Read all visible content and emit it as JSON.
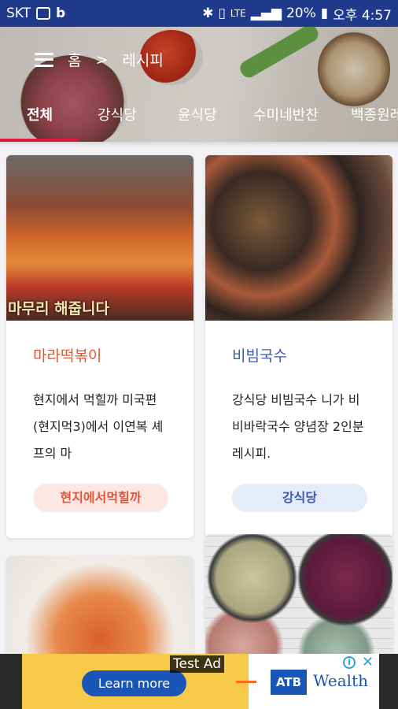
{
  "status_bar": {
    "carrier": "SKT",
    "network": "LTE",
    "battery": "20%",
    "time": "오후 4:57",
    "icons": [
      "gallery-icon",
      "b-app-icon",
      "bluetooth-icon",
      "vibrate-icon",
      "signal-icon",
      "battery-icon"
    ]
  },
  "header": {
    "breadcrumb": {
      "home": "홈",
      "separator": ">",
      "current": "레시피"
    },
    "tabs": [
      {
        "label": "전체",
        "active": true
      },
      {
        "label": "강식당",
        "active": false
      },
      {
        "label": "윤식당",
        "active": false
      },
      {
        "label": "수미네반찬",
        "active": false
      },
      {
        "label": "백종원레",
        "active": false
      }
    ],
    "indicator_color": "#e0143c"
  },
  "recipes": [
    {
      "image_caption": "마무리 해줍니다",
      "title": "마라떡볶이",
      "title_color": "#e0563a",
      "description": "현지에서 먹힐까 미국편(현지먹3)에서 이연복 셰프의 마",
      "tag": "현지에서먹힐까",
      "tag_color": "#e0563a",
      "tag_bg": "#fde7e4"
    },
    {
      "image_caption": "",
      "title": "비빔국수",
      "title_color": "#3b5bb5",
      "description": "강식당 비빔국수 니가 비비바락국수 양념장 2인분 레시피.",
      "tag": "강식당",
      "tag_color": "#3b5bb5",
      "tag_bg": "#e6ebfa"
    }
  ],
  "ad": {
    "label": "Test Ad",
    "cta": "Learn more",
    "brand": "ATB",
    "brand_word": "Wealth",
    "info_symbol": "i",
    "close_symbol": "✕"
  }
}
